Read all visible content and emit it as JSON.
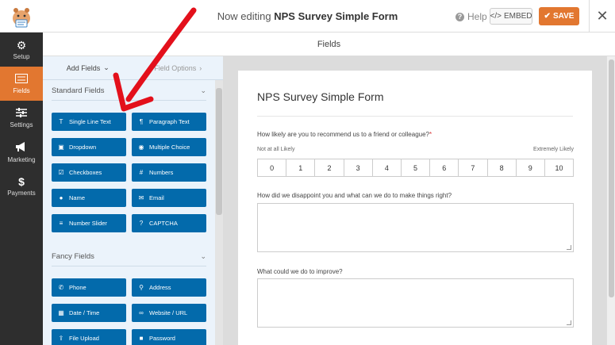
{
  "header": {
    "editing_prefix": "Now editing",
    "form_name": "NPS Survey Simple Form",
    "help_label": "Help",
    "embed_label": "EMBED",
    "save_label": "SAVE"
  },
  "nav": {
    "items": [
      {
        "label": "Setup",
        "icon": "gear-icon"
      },
      {
        "label": "Fields",
        "icon": "fields-icon"
      },
      {
        "label": "Settings",
        "icon": "sliders-icon"
      },
      {
        "label": "Marketing",
        "icon": "megaphone-icon"
      },
      {
        "label": "Payments",
        "icon": "dollar-icon"
      }
    ],
    "active": "Fields"
  },
  "fields_header": "Fields",
  "panel": {
    "tabs": {
      "add_fields": "Add Fields",
      "field_options": "Field Options"
    },
    "standard_title": "Standard Fields",
    "standard": [
      {
        "label": "Single Line Text",
        "icon": "text-icon"
      },
      {
        "label": "Paragraph Text",
        "icon": "paragraph-icon"
      },
      {
        "label": "Dropdown",
        "icon": "dropdown-icon"
      },
      {
        "label": "Multiple Choice",
        "icon": "radio-icon"
      },
      {
        "label": "Checkboxes",
        "icon": "checkbox-icon"
      },
      {
        "label": "Numbers",
        "icon": "hash-icon"
      },
      {
        "label": "Name",
        "icon": "user-icon"
      },
      {
        "label": "Email",
        "icon": "envelope-icon"
      },
      {
        "label": "Number Slider",
        "icon": "slider-icon"
      },
      {
        "label": "CAPTCHA",
        "icon": "question-icon"
      }
    ],
    "fancy_title": "Fancy Fields",
    "fancy": [
      {
        "label": "Phone",
        "icon": "phone-icon"
      },
      {
        "label": "Address",
        "icon": "map-pin-icon"
      },
      {
        "label": "Date / Time",
        "icon": "calendar-icon"
      },
      {
        "label": "Website / URL",
        "icon": "link-icon"
      },
      {
        "label": "File Upload",
        "icon": "upload-icon"
      },
      {
        "label": "Password",
        "icon": "lock-icon"
      }
    ]
  },
  "form": {
    "title": "NPS Survey Simple Form",
    "q1": "How likely are you to recommend us to a friend or colleague?",
    "q1_required": "*",
    "low_label": "Not at all Likely",
    "high_label": "Extremely Likely",
    "scale": [
      "0",
      "1",
      "2",
      "3",
      "4",
      "5",
      "6",
      "7",
      "8",
      "9",
      "10"
    ],
    "q2": "How did we disappoint you and what can we do to make things right?",
    "q3": "What could we do to improve?"
  },
  "colors": {
    "accent": "#e27730",
    "button": "#036aab",
    "nav_bg": "#2e2e2e",
    "arrow": "#e3101b"
  }
}
